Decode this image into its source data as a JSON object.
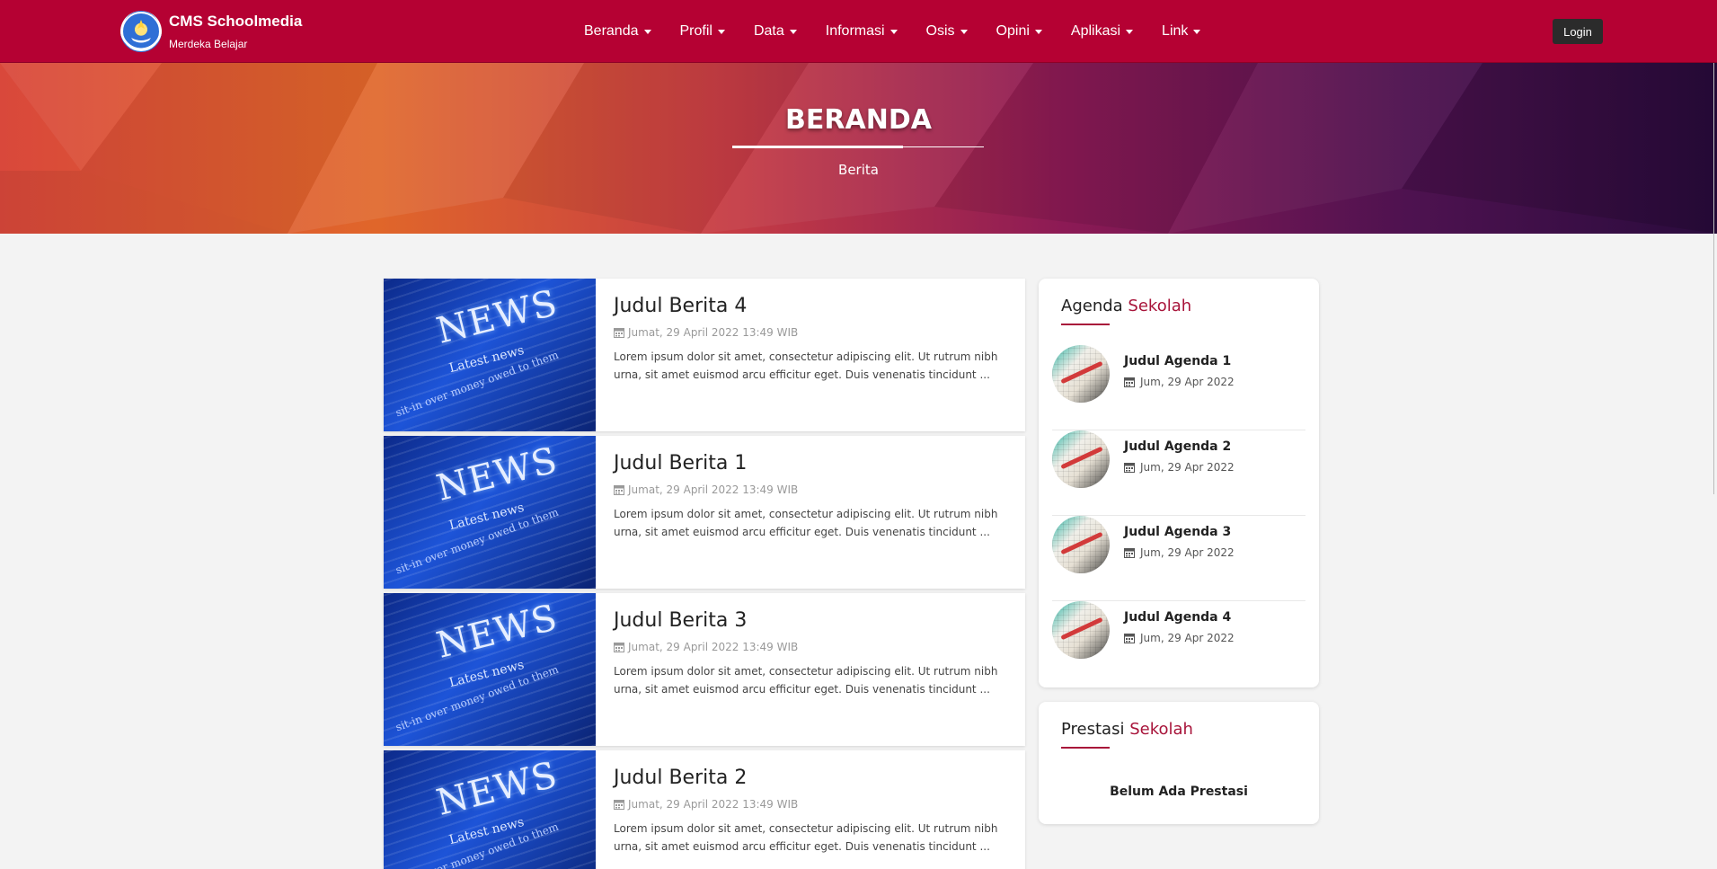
{
  "brand": {
    "title": "CMS Schoolmedia",
    "subtitle": "Merdeka Belajar"
  },
  "nav": {
    "items": [
      {
        "label": "Beranda"
      },
      {
        "label": "Profil"
      },
      {
        "label": "Data"
      },
      {
        "label": "Informasi"
      },
      {
        "label": "Osis"
      },
      {
        "label": "Opini"
      },
      {
        "label": "Aplikasi"
      },
      {
        "label": "Link"
      }
    ],
    "login_label": "Login"
  },
  "hero": {
    "title": "BERANDA",
    "subtitle": "Berita"
  },
  "news": [
    {
      "title": "Judul Berita 4",
      "date": "Jumat, 29 April 2022 13:49 WIB",
      "excerpt": "Lorem ipsum dolor sit amet, consectetur adipiscing elit. Ut rutrum nibh urna, sit amet euismod arcu efficitur eget. Duis venenatis tincidunt ..."
    },
    {
      "title": "Judul Berita 1",
      "date": "Jumat, 29 April 2022 13:49 WIB",
      "excerpt": "Lorem ipsum dolor sit amet, consectetur adipiscing elit. Ut rutrum nibh urna, sit amet euismod arcu efficitur eget. Duis venenatis tincidunt ..."
    },
    {
      "title": "Judul Berita 3",
      "date": "Jumat, 29 April 2022 13:49 WIB",
      "excerpt": "Lorem ipsum dolor sit amet, consectetur adipiscing elit. Ut rutrum nibh urna, sit amet euismod arcu efficitur eget. Duis venenatis tincidunt ..."
    },
    {
      "title": "Judul Berita 2",
      "date": "Jumat, 29 April 2022 13:49 WIB",
      "excerpt": "Lorem ipsum dolor sit amet, consectetur adipiscing elit. Ut rutrum nibh urna, sit amet euismod arcu efficitur eget. Duis venenatis tincidunt ..."
    }
  ],
  "news_thumb_text": {
    "headline": "NEWS",
    "line1": "Latest news",
    "line2": "sit-in over money owed to them"
  },
  "agenda": {
    "title_main": "Agenda",
    "title_accent": "Sekolah",
    "items": [
      {
        "title": "Judul Agenda 1",
        "date": "Jum, 29 Apr 2022"
      },
      {
        "title": "Judul Agenda 2",
        "date": "Jum, 29 Apr 2022"
      },
      {
        "title": "Judul Agenda 3",
        "date": "Jum, 29 Apr 2022"
      },
      {
        "title": "Judul Agenda 4",
        "date": "Jum, 29 Apr 2022"
      }
    ]
  },
  "prestasi": {
    "title_main": "Prestasi",
    "title_accent": "Sekolah",
    "empty_text": "Belum Ada Prestasi"
  },
  "colors": {
    "primary": "#b50133",
    "accent": "#a8143a",
    "login_bg": "#2b2b2b"
  },
  "icons": {
    "calendar": "calendar-icon",
    "caret": "caret-down-icon",
    "logo": "tut-wuri-handayani-logo"
  }
}
